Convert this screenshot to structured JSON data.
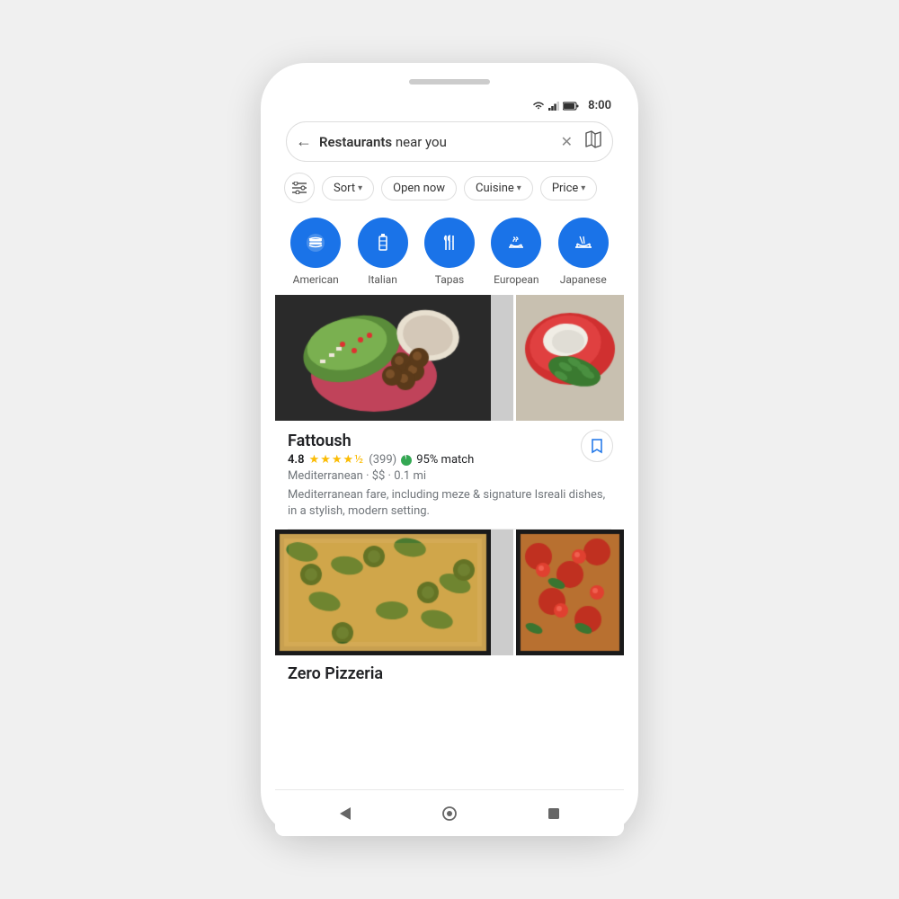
{
  "phone": {
    "status": {
      "time": "8:00"
    },
    "search": {
      "query_bold": "Restaurants",
      "query_rest": " near you",
      "placeholder": "Restaurants near you"
    },
    "filters": [
      {
        "id": "sort",
        "label": "Sort",
        "has_chevron": true
      },
      {
        "id": "open_now",
        "label": "Open now",
        "has_chevron": false
      },
      {
        "id": "cuisine",
        "label": "Cuisine",
        "has_chevron": true
      },
      {
        "id": "price",
        "label": "Price",
        "has_chevron": true
      }
    ],
    "categories": [
      {
        "id": "american",
        "label": "American",
        "icon": "🍔"
      },
      {
        "id": "italian",
        "label": "Italian",
        "icon": "🍕"
      },
      {
        "id": "tapas",
        "label": "Tapas",
        "icon": "🍴"
      },
      {
        "id": "european",
        "label": "European",
        "icon": "🍜"
      },
      {
        "id": "japanese",
        "label": "Japanese",
        "icon": "🍜"
      }
    ],
    "restaurants": [
      {
        "id": "fattoush",
        "name": "Fattoush",
        "rating": "4.8",
        "review_count": "(399)",
        "match_pct": "95% match",
        "cuisine": "Mediterranean",
        "price": "$$",
        "distance": "0.1 mi",
        "description": "Mediterranean fare, including meze & signature Isreali dishes, in a stylish, modern setting."
      },
      {
        "id": "zero-pizzeria",
        "name": "Zero Pizzeria",
        "rating": "",
        "review_count": "",
        "match_pct": "",
        "cuisine": "",
        "price": "",
        "distance": "",
        "description": ""
      }
    ],
    "nav": {
      "back": "◀",
      "home": "⬤",
      "recents": "■"
    }
  }
}
